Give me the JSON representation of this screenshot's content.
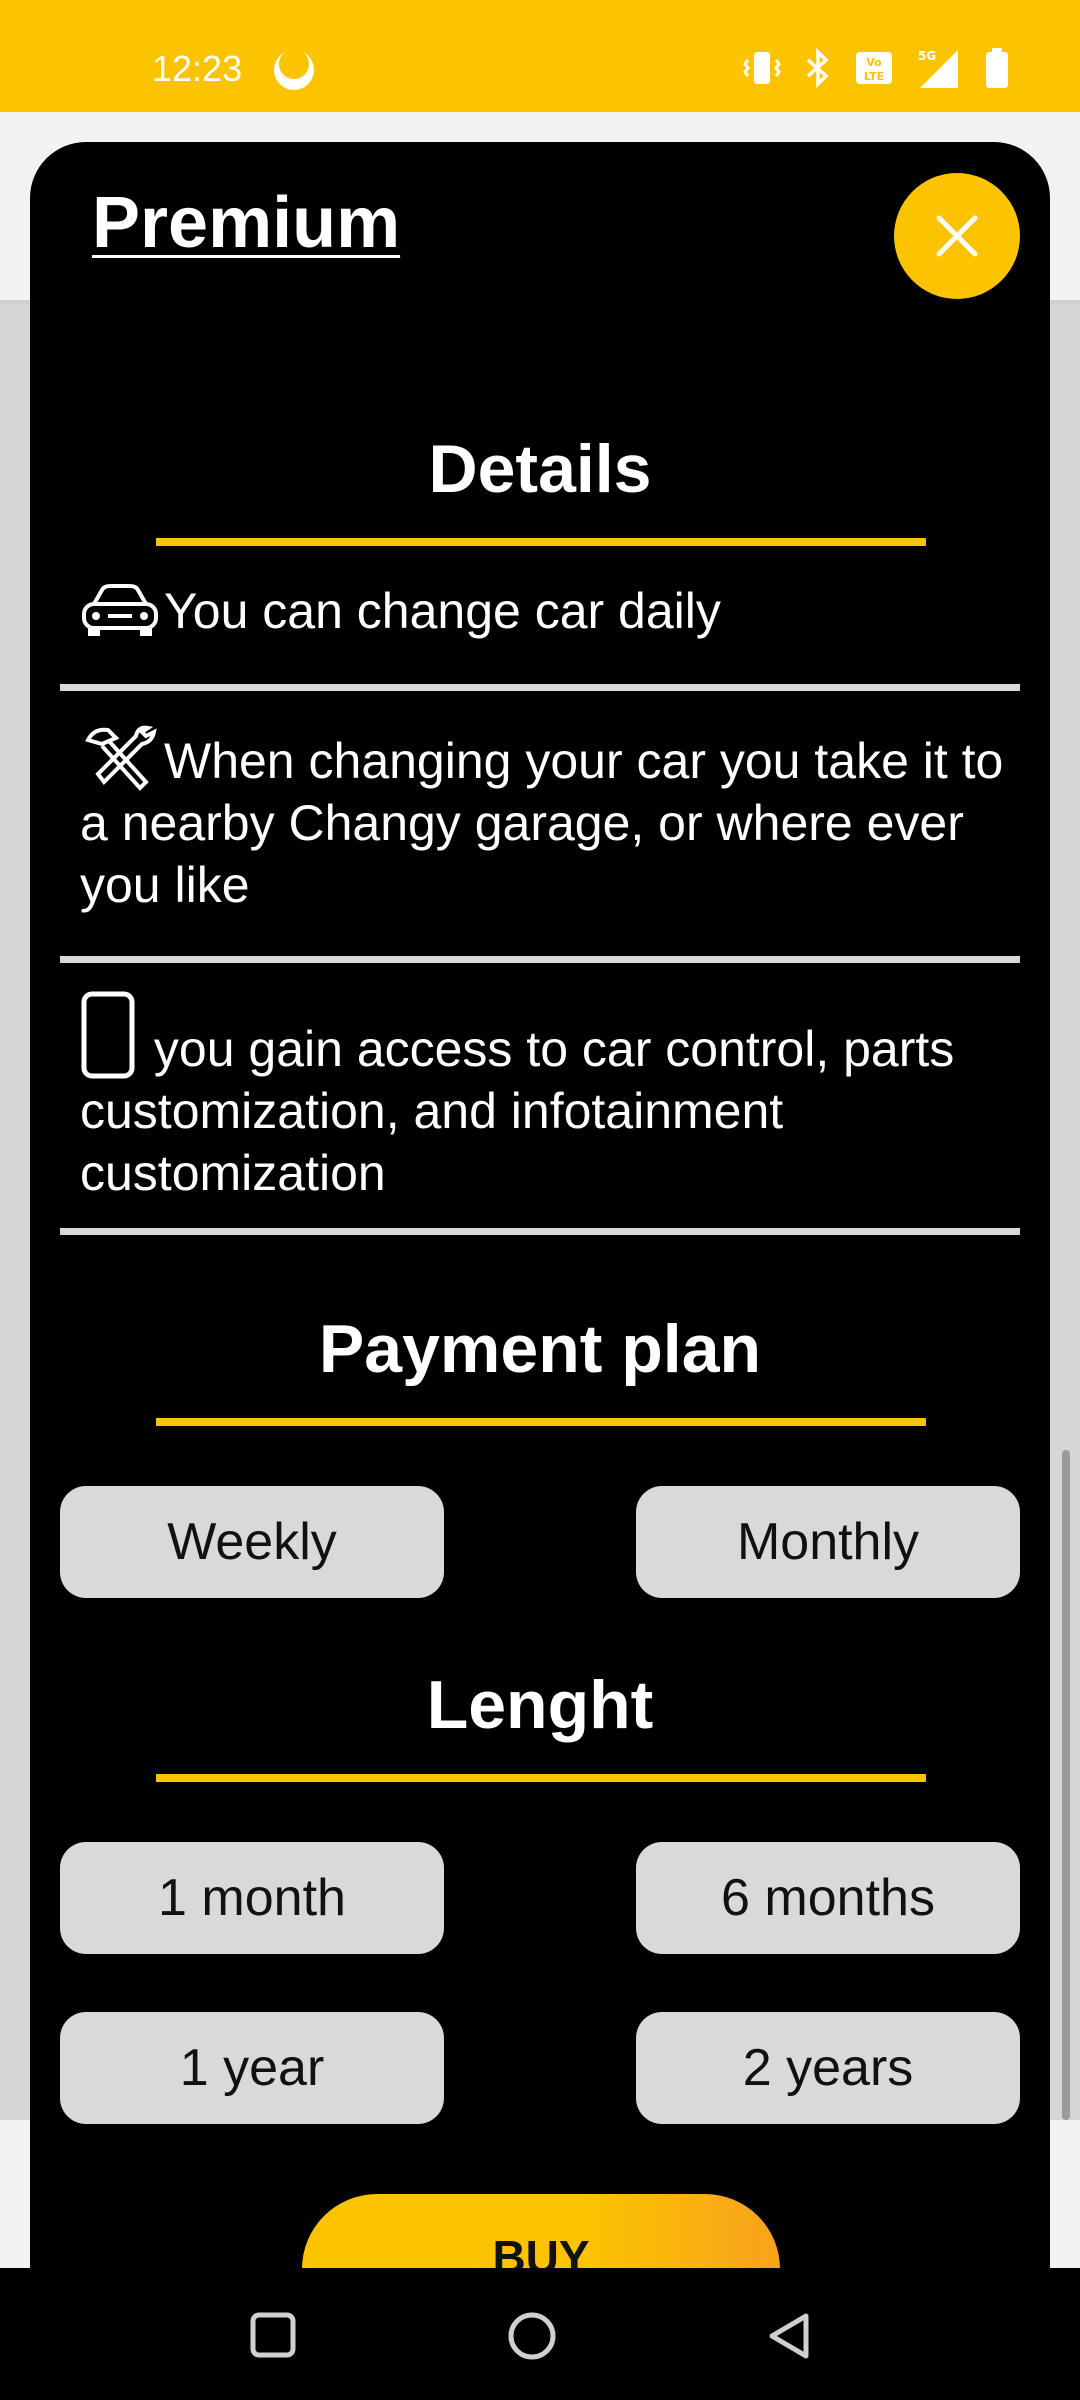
{
  "status_bar": {
    "time": "12:23",
    "icons": [
      "moon-icon",
      "vibrate-icon",
      "bluetooth-icon",
      "volte-icon",
      "signal-5g-icon",
      "battery-icon"
    ],
    "bg_color": "#fcc300"
  },
  "sheet": {
    "title": "Premium",
    "close_icon": "close-icon",
    "accent_color": "#fcc300",
    "details": {
      "heading": "Details",
      "items": [
        {
          "icon": "car-icon",
          "text": "You can change car daily"
        },
        {
          "icon": "tools-icon",
          "text": "When changing your car you take it to a nearby Changy garage, or where ever you like"
        },
        {
          "icon": "phone-icon",
          "text": " you gain access to car control, parts customization, and infotainment customization"
        }
      ]
    },
    "payment_plan": {
      "heading": "Payment plan",
      "options": [
        "Weekly",
        "Monthly"
      ]
    },
    "length": {
      "heading": "Lenght",
      "options": [
        "1 month",
        "6 months",
        "1 year",
        "2 years"
      ]
    },
    "buy_label": "BUY"
  },
  "nav_bar": {
    "icons": [
      "recents-square-icon",
      "home-circle-icon",
      "back-triangle-icon"
    ]
  }
}
